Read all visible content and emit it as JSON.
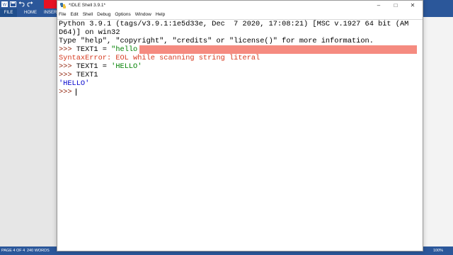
{
  "word": {
    "ribbon_tabs": [
      "FILE",
      "HOME",
      "INSERT"
    ],
    "status": {
      "page": "PAGE 4 OF 4",
      "words": "240 WORDS",
      "position": "Ln: 8  Col: 4",
      "zoom": "100%"
    }
  },
  "idle": {
    "title": "*IDLE Shell 3.9.1*",
    "menu": [
      "File",
      "Edit",
      "Shell",
      "Debug",
      "Options",
      "Window",
      "Help"
    ],
    "lines": {
      "banner1": "Python 3.9.1 (tags/v3.9.1:1e5d33e, Dec  7 2020, 17:08:21) [MSC v.1927 64 bit (AM",
      "banner2": "D64)] on win32",
      "banner3": "Type \"help\", \"copyright\", \"credits\" or \"license()\" for more information.",
      "prompt": ">>> ",
      "cmd1_prefix": "TEXT1 = ",
      "cmd1_string": "\"hello",
      "error": "SyntaxError: EOL while scanning string literal",
      "cmd2_prefix": "TEXT1 = ",
      "cmd2_string": "'HELLO'",
      "cmd3": "TEXT1",
      "output": "'HELLO'"
    }
  },
  "colors": {
    "word_blue": "#2b579a",
    "error_highlight": "#f58b80",
    "prompt": "#8b1a00",
    "string": "#008000",
    "error_text": "#d63a20",
    "output": "#0000cc"
  }
}
